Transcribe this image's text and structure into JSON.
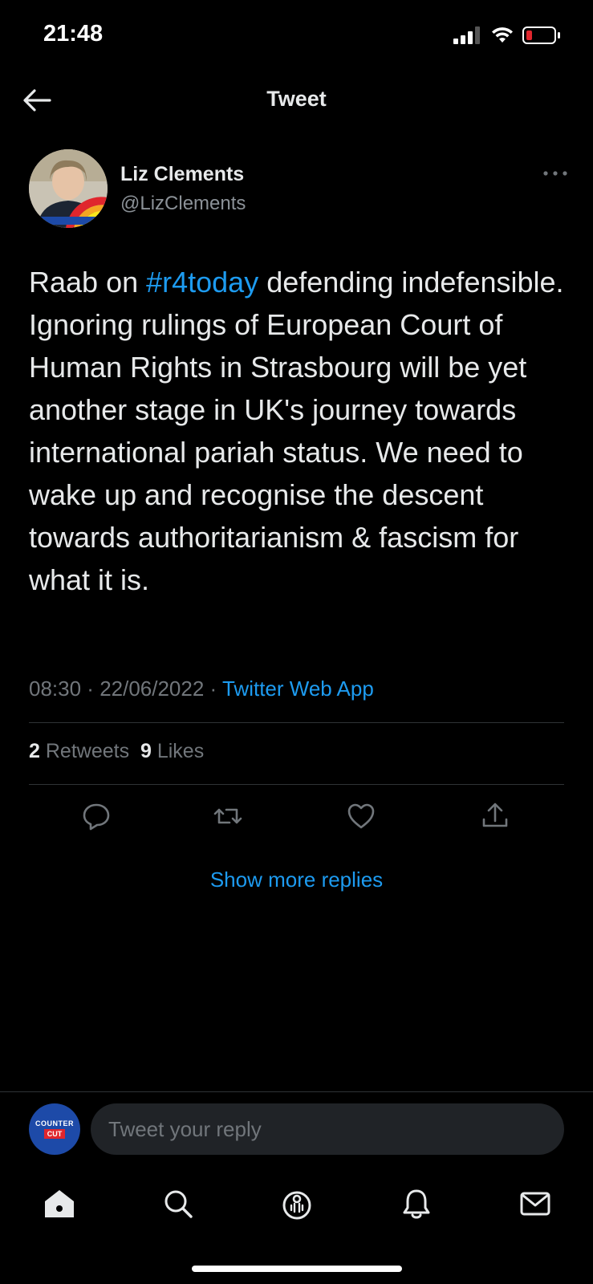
{
  "status_bar": {
    "time": "21:48",
    "battery": "low"
  },
  "header": {
    "title": "Tweet"
  },
  "author": {
    "name": "Liz Clements",
    "handle": "@LizClements"
  },
  "tweet": {
    "text_before": "Raab on ",
    "hashtag": "#r4today",
    "text_after": " defending indefensible. Ignoring rulings of European Court of Human Rights in Strasbourg will be yet another stage in UK's journey towards international pariah status. We need to wake up and recognise the descent towards authoritarianism & fascism for what it is.",
    "time": "08:30",
    "date": "22/06/2022",
    "source": "Twitter Web App"
  },
  "stats": {
    "retweets_count": "2",
    "retweets_label": "Retweets",
    "likes_count": "9",
    "likes_label": "Likes"
  },
  "show_more_replies": "Show more replies",
  "reply": {
    "placeholder": "Tweet your reply",
    "avatar_top": "COUNTER",
    "avatar_bottom": "CUT"
  },
  "colors": {
    "accent": "#1d9bf0",
    "background": "#000000",
    "muted": "#71767b",
    "battery_low": "#e0262d"
  },
  "icons": {
    "back": "arrow-left-icon",
    "more": "more-horizontal-icon",
    "actions": [
      "reply-icon",
      "retweet-icon",
      "like-icon",
      "share-icon"
    ],
    "nav": [
      "home-icon",
      "search-icon",
      "spaces-icon",
      "notifications-icon",
      "messages-icon"
    ]
  }
}
